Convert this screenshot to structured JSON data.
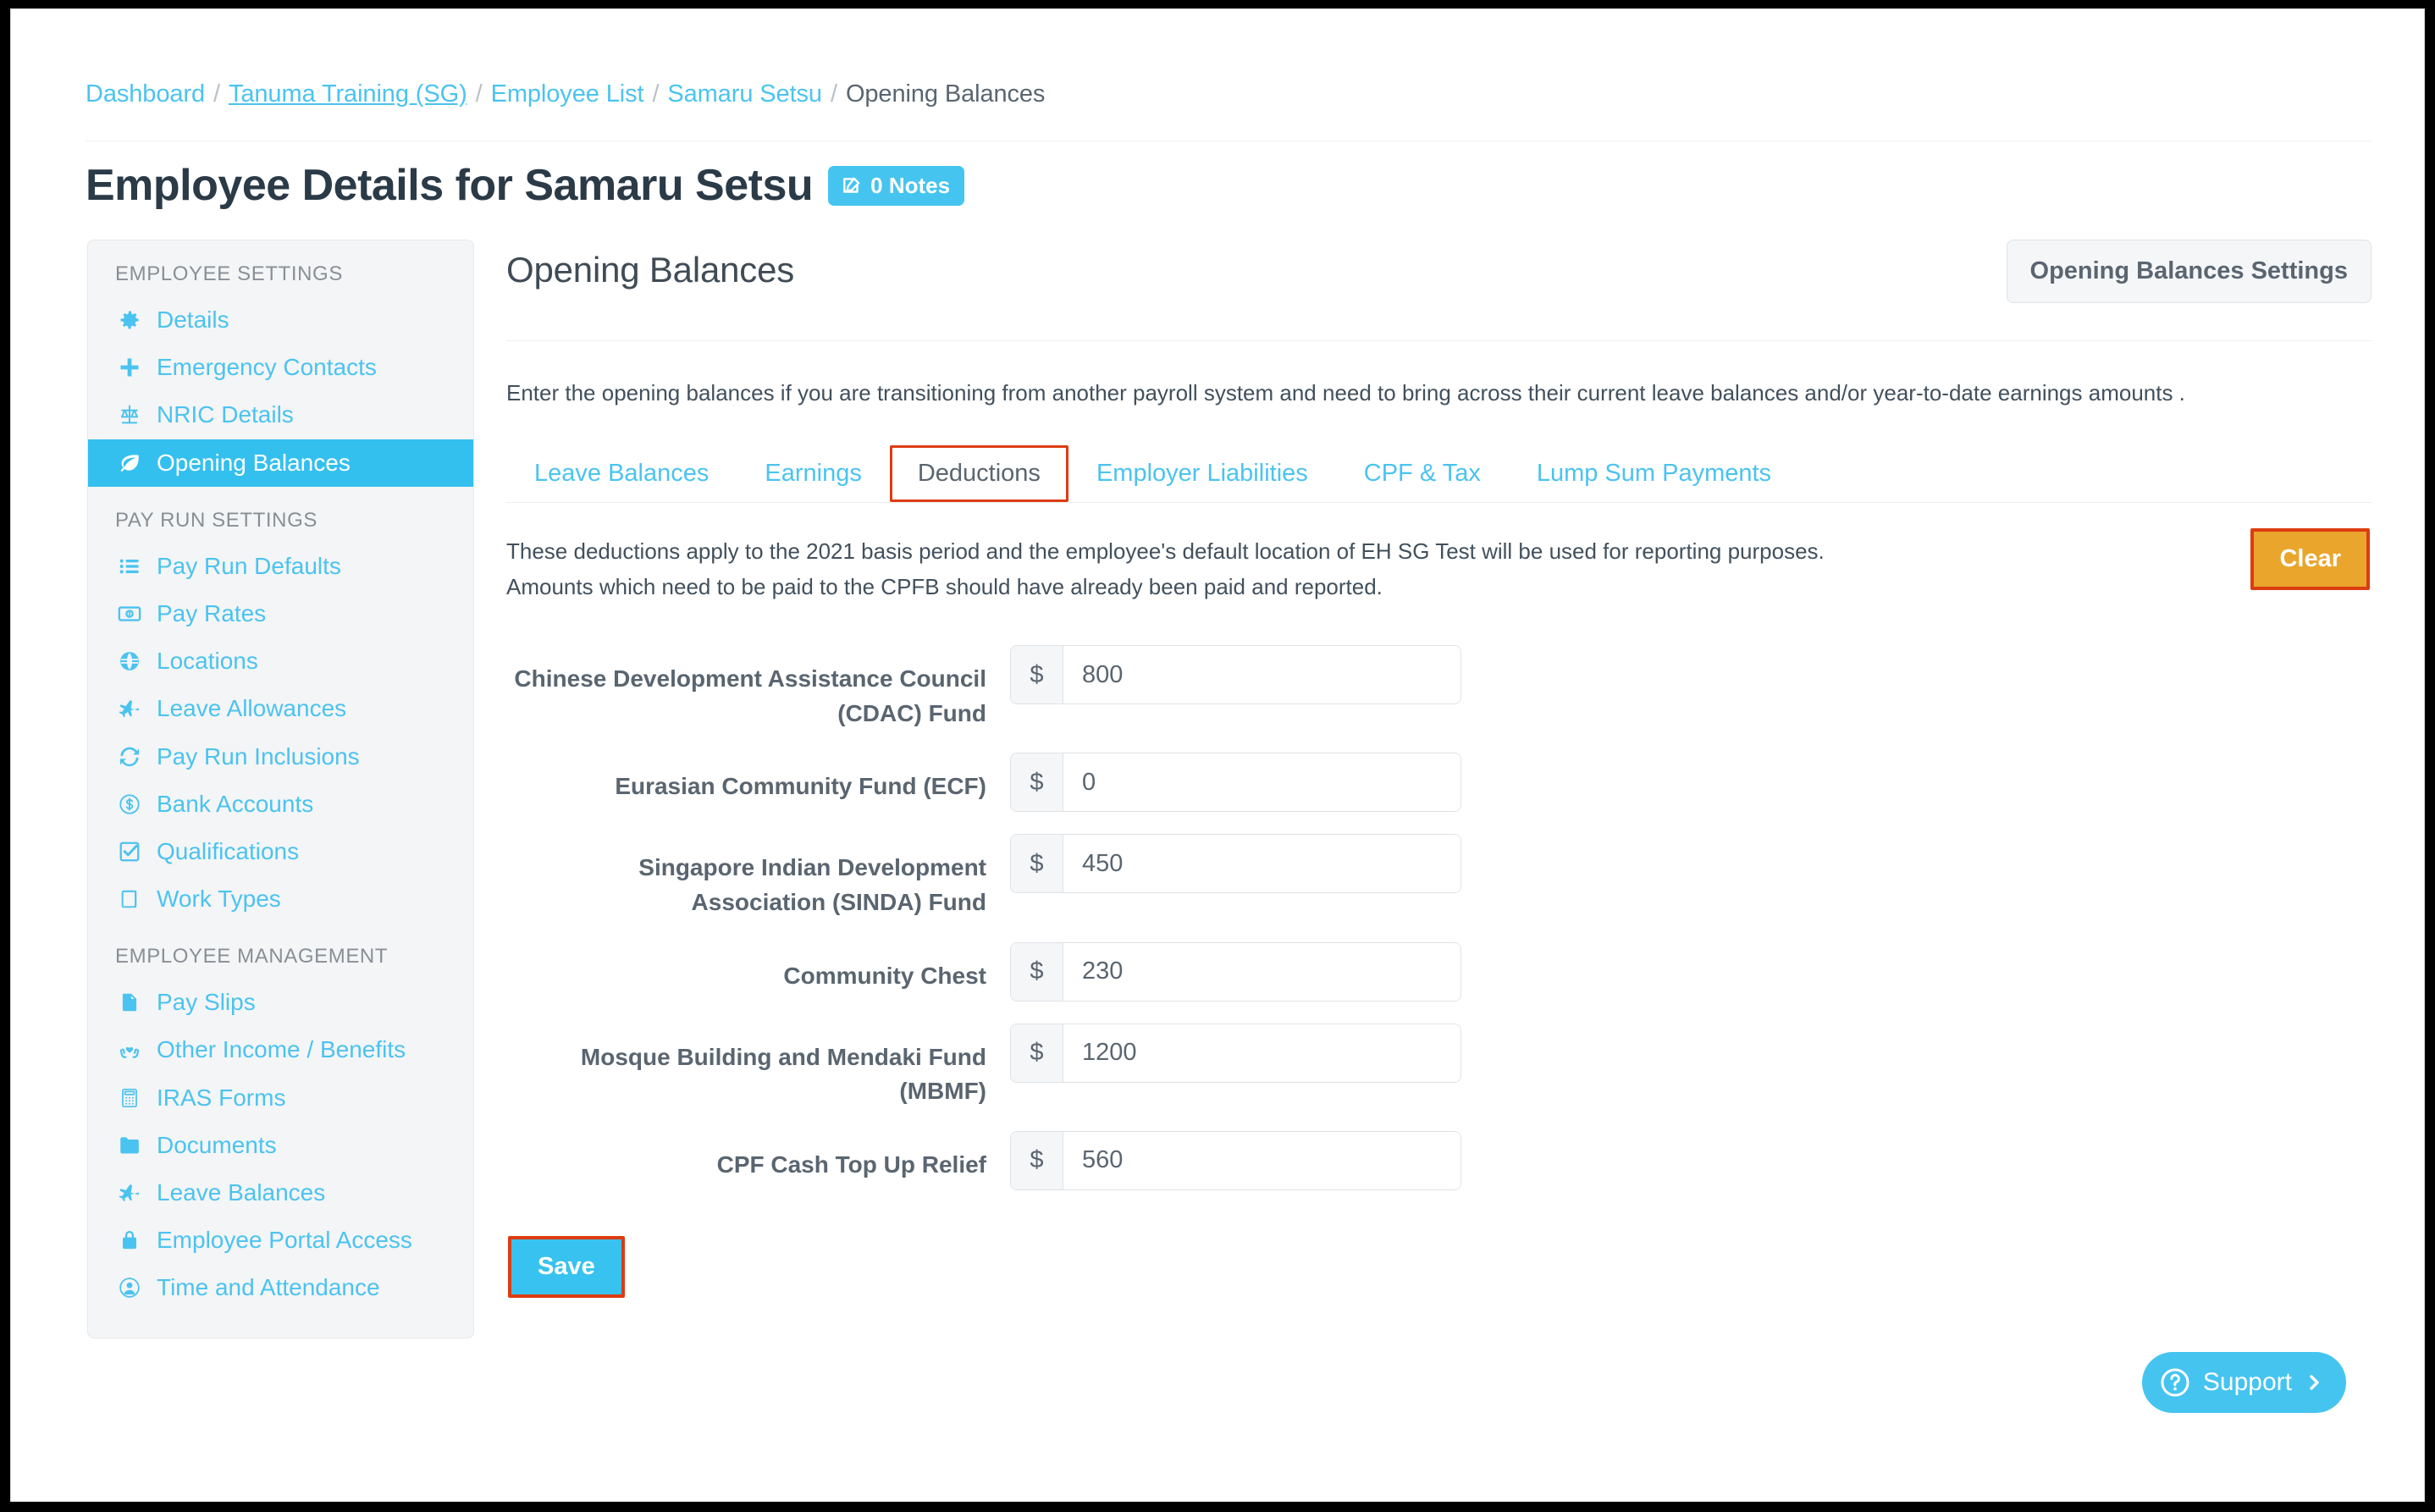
{
  "breadcrumb": {
    "items": [
      {
        "label": "Dashboard",
        "style": "link"
      },
      {
        "label": "Tanuma Training (SG)",
        "style": "link-underline"
      },
      {
        "label": "Employee List",
        "style": "link"
      },
      {
        "label": "Samaru Setsu",
        "style": "link"
      },
      {
        "label": "Opening Balances",
        "style": "current"
      }
    ],
    "separator": "/"
  },
  "header": {
    "title": "Employee Details for Samaru Setsu",
    "notes_badge": "0 Notes"
  },
  "sidebar": {
    "groups": [
      {
        "heading": "EMPLOYEE SETTINGS",
        "items": [
          {
            "label": "Details",
            "icon": "gear-icon",
            "active": false
          },
          {
            "label": "Emergency Contacts",
            "icon": "plus-icon",
            "active": false
          },
          {
            "label": "NRIC Details",
            "icon": "scales-icon",
            "active": false
          },
          {
            "label": "Opening Balances",
            "icon": "leaf-icon",
            "active": true
          }
        ]
      },
      {
        "heading": "PAY RUN SETTINGS",
        "items": [
          {
            "label": "Pay Run Defaults",
            "icon": "list-icon",
            "active": false
          },
          {
            "label": "Pay Rates",
            "icon": "banknote-icon",
            "active": false
          },
          {
            "label": "Locations",
            "icon": "globe-icon",
            "active": false
          },
          {
            "label": "Leave Allowances",
            "icon": "plane-icon",
            "active": false
          },
          {
            "label": "Pay Run Inclusions",
            "icon": "refresh-icon",
            "active": false
          },
          {
            "label": "Bank Accounts",
            "icon": "dollar-circle-icon",
            "active": false
          },
          {
            "label": "Qualifications",
            "icon": "checkbox-icon",
            "active": false
          },
          {
            "label": "Work Types",
            "icon": "book-icon",
            "active": false
          }
        ]
      },
      {
        "heading": "EMPLOYEE MANAGEMENT",
        "items": [
          {
            "label": "Pay Slips",
            "icon": "file-icon",
            "active": false
          },
          {
            "label": "Other Income / Benefits",
            "icon": "hands-heart-icon",
            "active": false
          },
          {
            "label": "IRAS Forms",
            "icon": "calculator-icon",
            "active": false
          },
          {
            "label": "Documents",
            "icon": "folder-icon",
            "active": false
          },
          {
            "label": "Leave Balances",
            "icon": "plane-icon",
            "active": false
          },
          {
            "label": "Employee Portal Access",
            "icon": "lock-icon",
            "active": false
          },
          {
            "label": "Time and Attendance",
            "icon": "user-circle-icon",
            "active": false
          }
        ]
      }
    ]
  },
  "main": {
    "section_title": "Opening Balances",
    "settings_button": "Opening Balances Settings",
    "intro": "Enter the opening balances if you are transitioning from another payroll system and need to bring across their current leave balances and/or year-to-date earnings amounts .",
    "tabs": [
      {
        "label": "Leave Balances",
        "active": false
      },
      {
        "label": "Earnings",
        "active": false
      },
      {
        "label": "Deductions",
        "active": true
      },
      {
        "label": "Employer Liabilities",
        "active": false
      },
      {
        "label": "CPF & Tax",
        "active": false
      },
      {
        "label": "Lump Sum Payments",
        "active": false
      }
    ],
    "notes_line_1": "These deductions apply to the 2021 basis period and the employee's default location of EH SG Test will be used for reporting purposes.",
    "notes_line_2": "Amounts which need to be paid to the CPFB should have already been paid and reported.",
    "clear_button": "Clear",
    "save_button": "Save",
    "currency_symbol": "$",
    "fields": [
      {
        "label": "Chinese Development Assistance Council (CDAC) Fund",
        "value": "800"
      },
      {
        "label": "Eurasian Community Fund (ECF)",
        "value": "0"
      },
      {
        "label": "Singapore Indian Development Association (SINDA) Fund",
        "value": "450"
      },
      {
        "label": "Community Chest",
        "value": "230"
      },
      {
        "label": "Mosque Building and Mendaki Fund (MBMF)",
        "value": "1200"
      },
      {
        "label": "CPF Cash Top Up Relief",
        "value": "560"
      }
    ]
  },
  "support": {
    "label": "Support",
    "help_icon": "question-circle-icon",
    "chevron_icon": "chevron-right-icon"
  },
  "colors": {
    "accent_blue": "#45c4f0",
    "link_blue": "#4bc3f0",
    "highlight_red": "#dd3c11",
    "clear_orange": "#eaa52d",
    "text_dark": "#2b3a47",
    "text_gray": "#5a6570",
    "sidebar_bg": "#f4f5f6"
  }
}
